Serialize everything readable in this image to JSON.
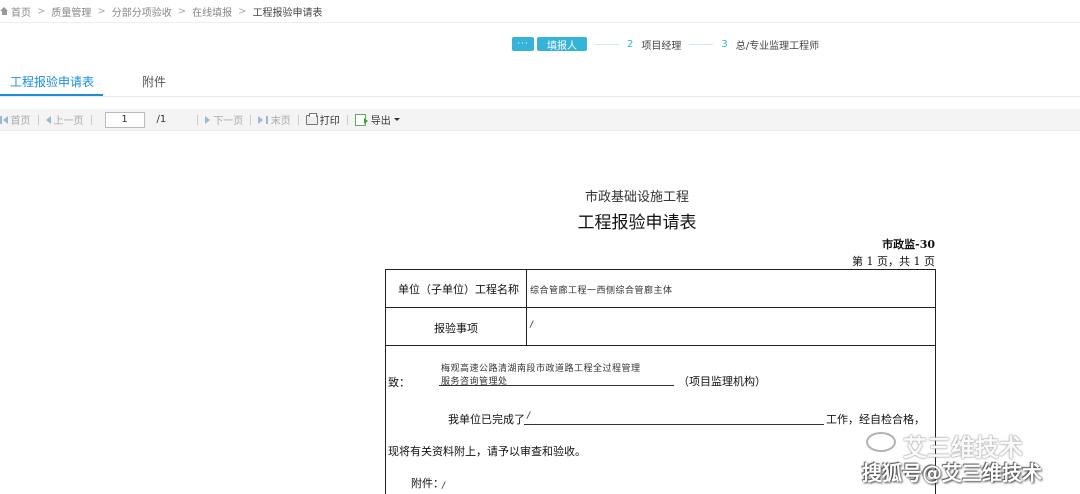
{
  "breadcrumb": {
    "items": [
      "首页",
      "质量管理",
      "分部分项验收",
      "在线填报",
      "工程报验申请表"
    ]
  },
  "workflow": {
    "dots": "···",
    "step1": "填报人",
    "step2_num": "2",
    "step2": "项目经理",
    "step3_num": "3",
    "step3": "总/专业监理工程师"
  },
  "tabs": [
    {
      "label": "工程报验申请表",
      "active": true
    },
    {
      "label": "附件",
      "active": false
    }
  ],
  "toolbar": {
    "first": "首页",
    "prev": "上一页",
    "page_value": "1",
    "page_total": "/1",
    "next": "下一页",
    "last": "末页",
    "print": "打印",
    "export": "导出"
  },
  "document": {
    "subtitle": "市政基础设施工程",
    "title": "工程报验申请表",
    "code": "市政监-30",
    "pages": "第 1 页，共 1 页",
    "project_label": "单位（子单位）工程名称",
    "project_value": "综合管廊工程一西侧综合管廊主体",
    "item_label": "报验事项",
    "item_value": "/",
    "to_label": "致：",
    "to_value_line1": "梅观高速公路清湖南段市政道路工程全过程管理",
    "to_value_line2": "服务咨询管理处",
    "to_suffix": "（项目监理机构）",
    "completed_prefix": "我单位已完成了",
    "completed_value": "/",
    "completed_suffix": "工作，经自检合格，",
    "submit_text": "现将有关资料附上，请予以审查和验收。",
    "attach_label": "附件：",
    "attach_value": "/"
  },
  "watermark": {
    "brand": "艾三维技术",
    "source": "搜狐号@艾三维技术"
  },
  "colors": {
    "accent": "#36b3d8",
    "tab_active": "#1a8fe0"
  }
}
